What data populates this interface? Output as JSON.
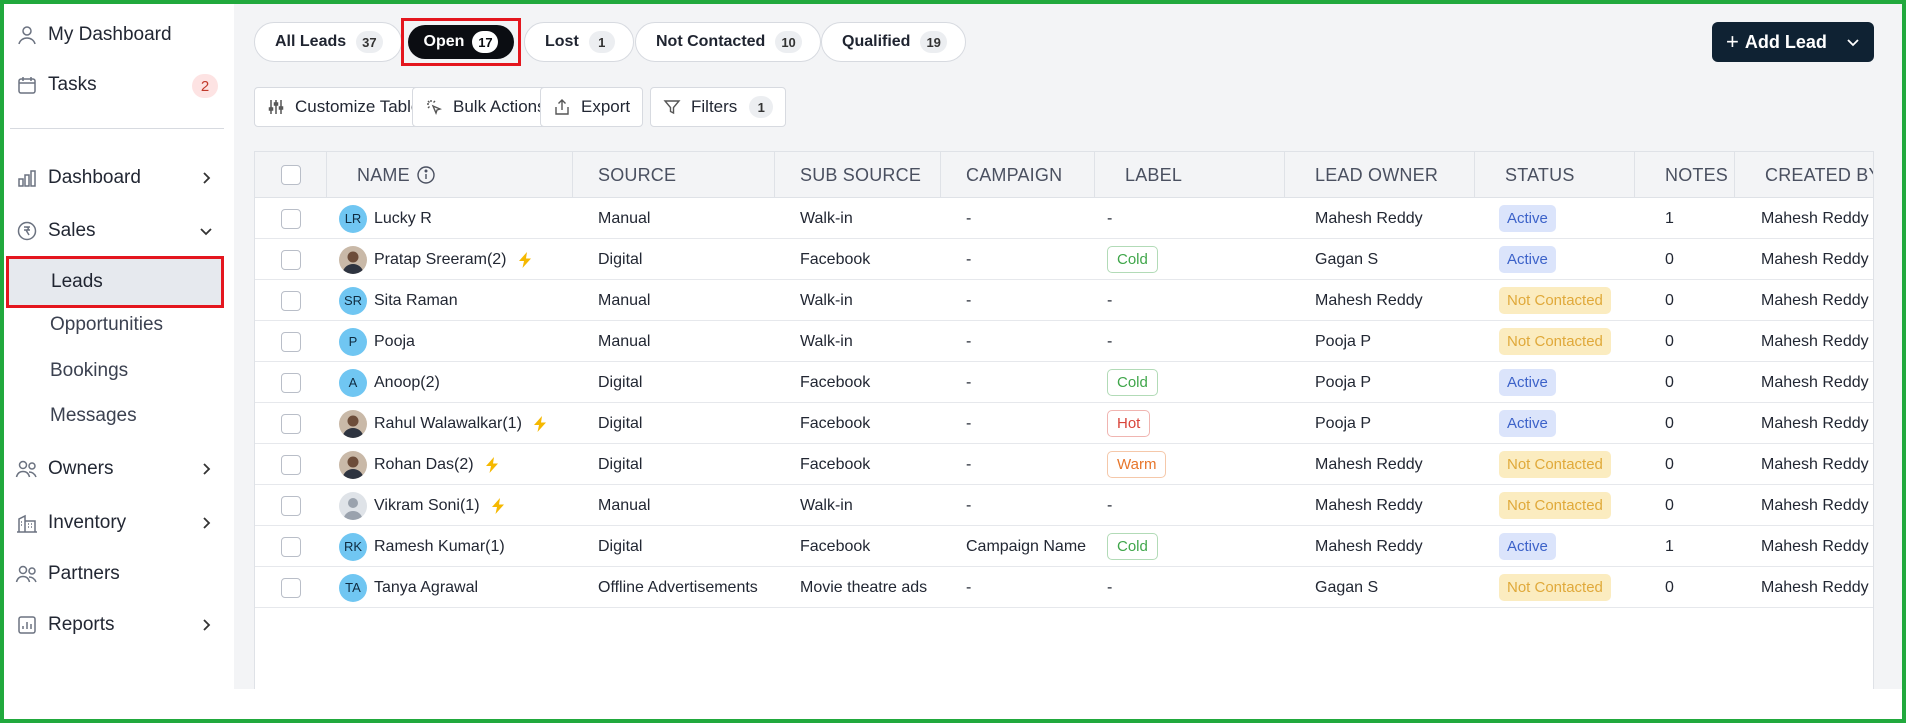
{
  "sidebar": {
    "my_dashboard": "My Dashboard",
    "tasks": "Tasks",
    "tasks_count": "2",
    "dashboard": "Dashboard",
    "sales": "Sales",
    "leads": "Leads",
    "opportunities": "Opportunities",
    "bookings": "Bookings",
    "messages": "Messages",
    "owners": "Owners",
    "inventory": "Inventory",
    "partners": "Partners",
    "reports": "Reports"
  },
  "tabs": [
    {
      "label": "All Leads",
      "count": "37"
    },
    {
      "label": "Open",
      "count": "17"
    },
    {
      "label": "Lost",
      "count": "1"
    },
    {
      "label": "Not Contacted",
      "count": "10"
    },
    {
      "label": "Qualified",
      "count": "19"
    }
  ],
  "add_lead": "Add Lead",
  "toolbar": {
    "customize": "Customize Table",
    "bulk": "Bulk Actions",
    "export": "Export",
    "filters": "Filters",
    "filters_count": "1"
  },
  "columns": {
    "name": "NAME",
    "source": "SOURCE",
    "sub_source": "SUB SOURCE",
    "campaign": "CAMPAIGN",
    "label": "LABEL",
    "lead_owner": "LEAD OWNER",
    "status": "STATUS",
    "notes": "NOTES",
    "created_by": "CREATED BY"
  },
  "colors": {
    "active_bg": "#dbe4fb",
    "active_fg": "#3c62c9",
    "nc_bg": "#fbecc0",
    "nc_fg": "#e0a93a",
    "cold": "#3fa64a",
    "hot": "#d9453b",
    "warm": "#e7762b"
  },
  "rows": [
    {
      "initials": "LR",
      "avatar": "initials",
      "name": "Lucky R",
      "bolt": false,
      "source": "Manual",
      "sub_source": "Walk-in",
      "campaign": "-",
      "label": "-",
      "owner": "Mahesh Reddy",
      "status": "Active",
      "notes": "1",
      "created_by": "Mahesh Reddy"
    },
    {
      "initials": "",
      "avatar": "photo",
      "name": "Pratap Sreeram(2)",
      "bolt": true,
      "source": "Digital",
      "sub_source": "Facebook",
      "campaign": "-",
      "label": "Cold",
      "owner": "Gagan S",
      "status": "Active",
      "notes": "0",
      "created_by": "Mahesh Reddy"
    },
    {
      "initials": "SR",
      "avatar": "initials",
      "name": "Sita Raman",
      "bolt": false,
      "source": "Manual",
      "sub_source": "Walk-in",
      "campaign": "-",
      "label": "-",
      "owner": "Mahesh Reddy",
      "status": "Not Contacted",
      "notes": "0",
      "created_by": "Mahesh Reddy"
    },
    {
      "initials": "P",
      "avatar": "initials",
      "name": "Pooja",
      "bolt": false,
      "source": "Manual",
      "sub_source": "Walk-in",
      "campaign": "-",
      "label": "-",
      "owner": "Pooja P",
      "status": "Not Contacted",
      "notes": "0",
      "created_by": "Mahesh Reddy"
    },
    {
      "initials": "A",
      "avatar": "initials",
      "name": "Anoop(2)",
      "bolt": false,
      "source": "Digital",
      "sub_source": "Facebook",
      "campaign": "-",
      "label": "Cold",
      "owner": "Pooja P",
      "status": "Active",
      "notes": "0",
      "created_by": "Mahesh Reddy"
    },
    {
      "initials": "",
      "avatar": "photo",
      "name": "Rahul Walawalkar(1)",
      "bolt": true,
      "source": "Digital",
      "sub_source": "Facebook",
      "campaign": "-",
      "label": "Hot",
      "owner": "Pooja P",
      "status": "Active",
      "notes": "0",
      "created_by": "Mahesh Reddy"
    },
    {
      "initials": "",
      "avatar": "photo",
      "name": "Rohan Das(2)",
      "bolt": true,
      "source": "Digital",
      "sub_source": "Facebook",
      "campaign": "-",
      "label": "Warm",
      "owner": "Mahesh Reddy",
      "status": "Not Contacted",
      "notes": "0",
      "created_by": "Mahesh Reddy"
    },
    {
      "initials": "",
      "avatar": "placeholder",
      "name": "Vikram Soni(1)",
      "bolt": true,
      "source": "Manual",
      "sub_source": "Walk-in",
      "campaign": "-",
      "label": "-",
      "owner": "Mahesh Reddy",
      "status": "Not Contacted",
      "notes": "0",
      "created_by": "Mahesh Reddy"
    },
    {
      "initials": "RK",
      "avatar": "initials",
      "name": "Ramesh Kumar(1)",
      "bolt": false,
      "source": "Digital",
      "sub_source": "Facebook",
      "campaign": "Campaign Name",
      "label": "Cold",
      "owner": "Mahesh Reddy",
      "status": "Active",
      "notes": "1",
      "created_by": "Mahesh Reddy"
    },
    {
      "initials": "TA",
      "avatar": "initials",
      "name": "Tanya Agrawal",
      "bolt": false,
      "source": "Offline Advertisements",
      "sub_source": "Movie theatre ads",
      "campaign": "-",
      "label": "-",
      "owner": "Gagan S",
      "status": "Not Contacted",
      "notes": "0",
      "created_by": "Mahesh Reddy"
    }
  ]
}
